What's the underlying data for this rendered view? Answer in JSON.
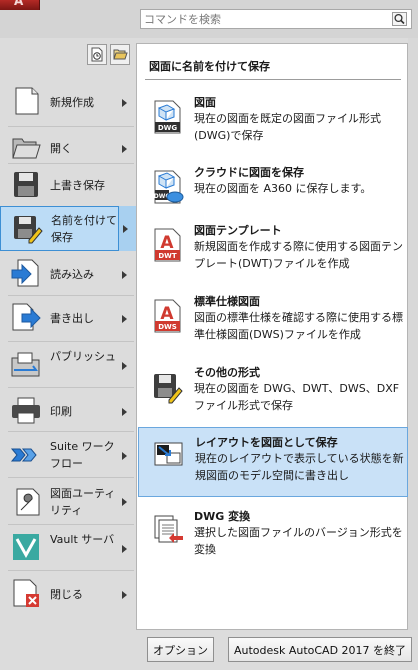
{
  "search": {
    "placeholder": "コマンドを検索"
  },
  "menu": {
    "items": [
      {
        "label": "新規作成",
        "icon": "new-document-icon",
        "has_submenu": true
      },
      {
        "label": "開く",
        "icon": "open-folder-icon",
        "has_submenu": true
      },
      {
        "label": "上書き保存",
        "icon": "save-disk-icon",
        "has_submenu": false
      },
      {
        "label": "名前を付けて保存",
        "icon": "save-as-icon",
        "has_submenu": true,
        "selected": true
      },
      {
        "label": "読み込み",
        "icon": "import-icon",
        "has_submenu": true
      },
      {
        "label": "書き出し",
        "icon": "export-icon",
        "has_submenu": true
      },
      {
        "label": "パブリッシュ",
        "icon": "publish-icon",
        "has_submenu": true
      },
      {
        "label": "印刷",
        "icon": "printer-icon",
        "has_submenu": true
      },
      {
        "label": "Suite ワークフロー",
        "icon": "suite-workflow-icon",
        "has_submenu": true
      },
      {
        "label": "図面ユーティリティ",
        "icon": "wrench-icon",
        "has_submenu": true
      },
      {
        "label": "Vault サーバ",
        "icon": "vault-icon",
        "has_submenu": true
      },
      {
        "label": "閉じる",
        "icon": "close-document-icon",
        "has_submenu": true
      }
    ]
  },
  "panel": {
    "title": "図面に名前を付けて保存",
    "items": [
      {
        "title": "図面",
        "description": "現在の図面を既定の図面ファイル形式(DWG)で保存",
        "icon": "dwg-file-icon"
      },
      {
        "title": "クラウドに図面を保存",
        "description": "現在の図面を A360 に保存します。",
        "icon": "cloud-dwg-icon"
      },
      {
        "title": "図面テンプレート",
        "description": "新規図面を作成する際に使用する図面テンプレート(DWT)ファイルを作成",
        "icon": "dwt-file-icon"
      },
      {
        "title": "標準仕様図面",
        "description": "図面の標準仕様を確認する際に使用する標準仕様図面(DWS)ファイルを作成",
        "icon": "dws-file-icon"
      },
      {
        "title": "その他の形式",
        "description": "現在の図面を DWG、DWT、DWS、DXF ファイル形式で保存",
        "icon": "other-formats-icon"
      },
      {
        "title": "レイアウトを図面として保存",
        "description": "現在のレイアウトで表示している状態を新規図面のモデル空間に書き出し",
        "icon": "layout-save-icon",
        "highlighted": true
      },
      {
        "title": "DWG 変換",
        "description": "選択した図面ファイルのバージョン形式を変換",
        "icon": "dwg-convert-icon"
      }
    ]
  },
  "footer": {
    "options_label": "オプション",
    "exit_label": "Autodesk AutoCAD 2017 を終了"
  },
  "colors": {
    "selected_bg": "#bcdcf6",
    "selected_border": "#3d8fd4",
    "logo_red": "#b52a26"
  }
}
